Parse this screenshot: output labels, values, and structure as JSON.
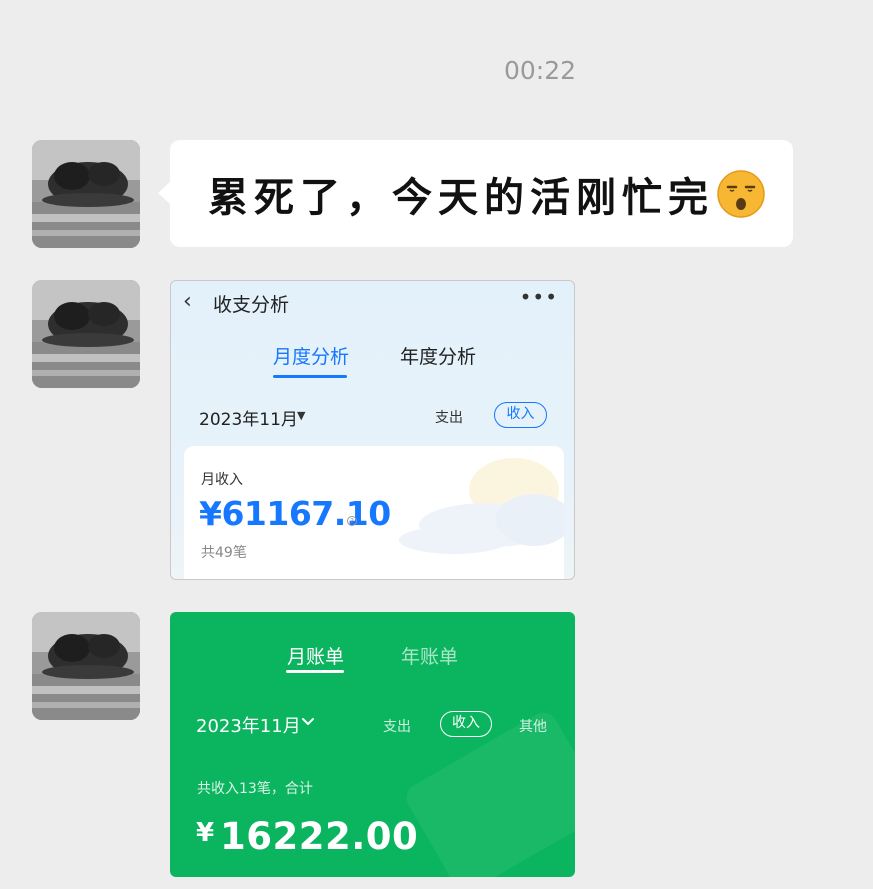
{
  "chat": {
    "timestamp": "00:22",
    "message_text": "累死了，今天的活刚忙完"
  },
  "alipay_screenshot": {
    "back_label": "‹",
    "title": "收支分析",
    "more_label": "•••",
    "tabs": [
      {
        "label": "月度分析",
        "active": true
      },
      {
        "label": "年度分析",
        "active": false
      }
    ],
    "month": "2023年11月",
    "toggle_expense": "支出",
    "toggle_income": "收入",
    "card_label": "月收入",
    "amount": "¥61167.10",
    "info_mark": "?",
    "count": "共49笔",
    "accent_color": "#1677ff"
  },
  "wechat_screenshot": {
    "tabs": [
      {
        "label": "月账单",
        "active": true
      },
      {
        "label": "年账单",
        "active": false
      }
    ],
    "month": "2023年11月",
    "toggle_expense": "支出",
    "toggle_income": "收入",
    "toggle_other": "其他",
    "summary": "共收入13笔，合计",
    "currency": "¥",
    "amount": "16222.00",
    "background_color": "#0bb55f"
  }
}
